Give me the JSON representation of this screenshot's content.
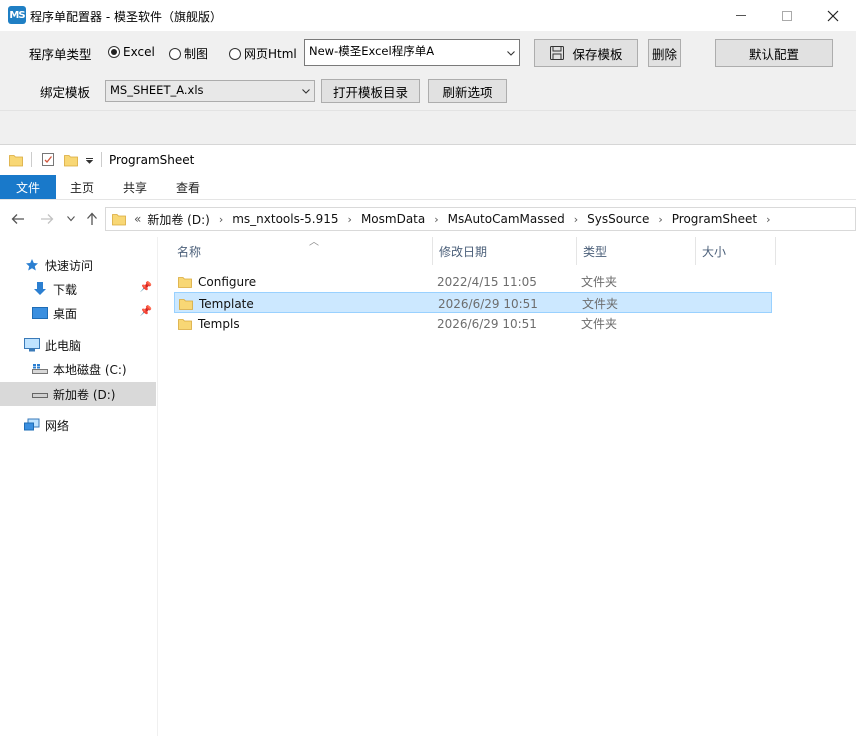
{
  "window": {
    "logo_text": "MS",
    "title": "程序单配置器 - 模圣软件（旗舰版）"
  },
  "config": {
    "type_label": "程序单类型",
    "options": [
      "Excel",
      "制图",
      "网页Html"
    ],
    "selected_option": "Excel",
    "program_combo_value": "New-模圣Excel程序单A",
    "save_template_label": "保存模板",
    "delete_label": "删除",
    "default_config_label": "默认配置",
    "bind_template_label": "绑定模板",
    "template_combo_value": "MS_SHEET_A.xls",
    "open_dir_label": "打开模板目录",
    "refresh_label": "刷新选项"
  },
  "explorer": {
    "qa_title": "ProgramSheet",
    "ribbon_tabs": [
      "文件",
      "主页",
      "共享",
      "查看"
    ],
    "breadcrumb": [
      "新加卷 (D:)",
      "ms_nxtools-5.915",
      "MosmData",
      "MsAutoCamMassed",
      "SysSource",
      "ProgramSheet"
    ],
    "breadcrumb_overflow": "«",
    "sidebar": [
      {
        "label": "快速访问",
        "icon": "star-icon",
        "pinned": false
      },
      {
        "label": "下载",
        "icon": "download-icon",
        "pinned": true
      },
      {
        "label": "桌面",
        "icon": "desktop-icon",
        "pinned": true
      },
      {
        "label": "此电脑",
        "icon": "computer-icon",
        "pinned": false
      },
      {
        "label": "本地磁盘 (C:)",
        "icon": "drive-c-icon",
        "pinned": false
      },
      {
        "label": "新加卷 (D:)",
        "icon": "drive-d-icon",
        "pinned": false,
        "selected": true
      },
      {
        "label": "网络",
        "icon": "network-icon",
        "pinned": false
      }
    ],
    "columns": [
      "名称",
      "修改日期",
      "类型",
      "大小"
    ],
    "files": [
      {
        "name": "Configure",
        "date": "2022/4/15 11:05",
        "type": "文件夹",
        "size": ""
      },
      {
        "name": "Template",
        "date": "2026/6/29 10:51",
        "type": "文件夹",
        "size": "",
        "selected": true
      },
      {
        "name": "Templs",
        "date": "2026/6/29 10:51",
        "type": "文件夹",
        "size": ""
      }
    ]
  },
  "colors": {
    "accent": "#1979ca",
    "selection": "#cce8ff",
    "folder": "#f8d775"
  }
}
